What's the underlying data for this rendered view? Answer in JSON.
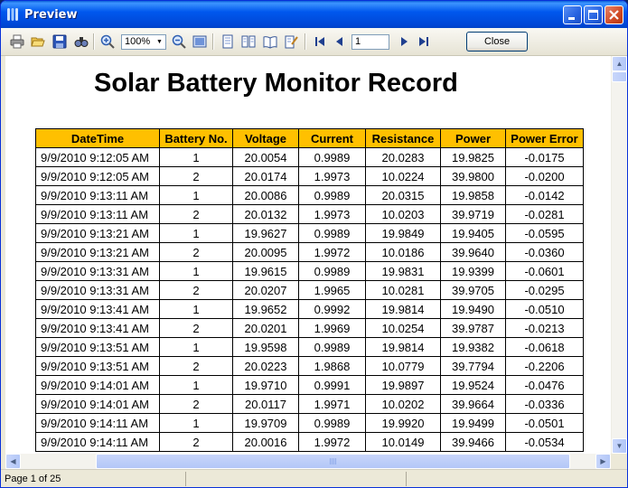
{
  "window": {
    "title": "Preview"
  },
  "toolbar": {
    "zoom_value": "100%",
    "page_value": "1",
    "close_label": "Close"
  },
  "report": {
    "title": "Solar Battery Monitor Record",
    "header_color": "#ffc000",
    "columns": [
      "DateTime",
      "Battery No.",
      "Voltage",
      "Current",
      "Resistance",
      "Power",
      "Power Error"
    ],
    "rows": [
      [
        "9/9/2010 9:12:05 AM",
        "1",
        "20.0054",
        "0.9989",
        "20.0283",
        "19.9825",
        "-0.0175"
      ],
      [
        "9/9/2010 9:12:05 AM",
        "2",
        "20.0174",
        "1.9973",
        "10.0224",
        "39.9800",
        "-0.0200"
      ],
      [
        "9/9/2010 9:13:11 AM",
        "1",
        "20.0086",
        "0.9989",
        "20.0315",
        "19.9858",
        "-0.0142"
      ],
      [
        "9/9/2010 9:13:11 AM",
        "2",
        "20.0132",
        "1.9973",
        "10.0203",
        "39.9719",
        "-0.0281"
      ],
      [
        "9/9/2010 9:13:21 AM",
        "1",
        "19.9627",
        "0.9989",
        "19.9849",
        "19.9405",
        "-0.0595"
      ],
      [
        "9/9/2010 9:13:21 AM",
        "2",
        "20.0095",
        "1.9972",
        "10.0186",
        "39.9640",
        "-0.0360"
      ],
      [
        "9/9/2010 9:13:31 AM",
        "1",
        "19.9615",
        "0.9989",
        "19.9831",
        "19.9399",
        "-0.0601"
      ],
      [
        "9/9/2010 9:13:31 AM",
        "2",
        "20.0207",
        "1.9965",
        "10.0281",
        "39.9705",
        "-0.0295"
      ],
      [
        "9/9/2010 9:13:41 AM",
        "1",
        "19.9652",
        "0.9992",
        "19.9814",
        "19.9490",
        "-0.0510"
      ],
      [
        "9/9/2010 9:13:41 AM",
        "2",
        "20.0201",
        "1.9969",
        "10.0254",
        "39.9787",
        "-0.0213"
      ],
      [
        "9/9/2010 9:13:51 AM",
        "1",
        "19.9598",
        "0.9989",
        "19.9814",
        "19.9382",
        "-0.0618"
      ],
      [
        "9/9/2010 9:13:51 AM",
        "2",
        "20.0223",
        "1.9868",
        "10.0779",
        "39.7794",
        "-0.2206"
      ],
      [
        "9/9/2010 9:14:01 AM",
        "1",
        "19.9710",
        "0.9991",
        "19.9897",
        "19.9524",
        "-0.0476"
      ],
      [
        "9/9/2010 9:14:01 AM",
        "2",
        "20.0117",
        "1.9971",
        "10.0202",
        "39.9664",
        "-0.0336"
      ],
      [
        "9/9/2010 9:14:11 AM",
        "1",
        "19.9709",
        "0.9989",
        "19.9920",
        "19.9499",
        "-0.0501"
      ],
      [
        "9/9/2010 9:14:11 AM",
        "2",
        "20.0016",
        "1.9972",
        "10.0149",
        "39.9466",
        "-0.0534"
      ]
    ]
  },
  "status": {
    "page_text": "Page 1 of 25"
  }
}
